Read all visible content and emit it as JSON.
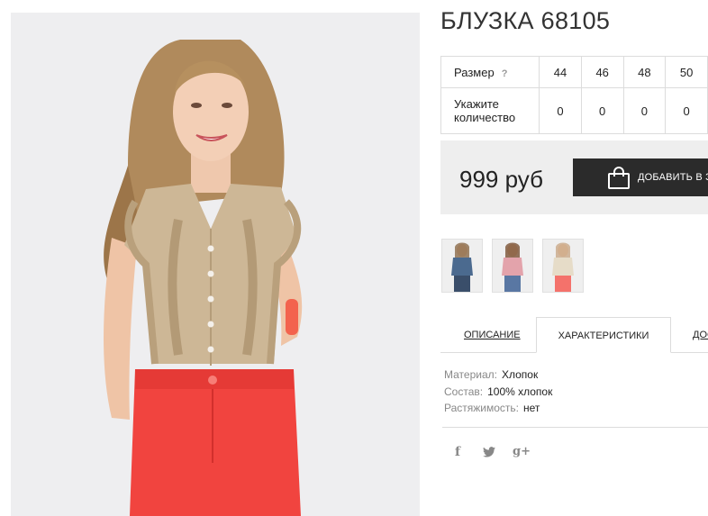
{
  "product": {
    "title": "БЛУЗКА 68105"
  },
  "size_table": {
    "size_label": "Размер",
    "help": "?",
    "sizes": [
      "44",
      "46",
      "48",
      "50"
    ],
    "qty_label": "Укажите количество",
    "qty": [
      "0",
      "0",
      "0",
      "0"
    ]
  },
  "price": {
    "value": "999 руб",
    "button": "ДОБАВИТЬ В З"
  },
  "tabs": {
    "description": "ОПИСАНИЕ",
    "characteristics": "ХАРАКТЕРИСТИКИ",
    "third": "ДОС"
  },
  "characteristics": [
    {
      "key": "Материал:",
      "value": "Хлопок"
    },
    {
      "key": "Состав:",
      "value": "100% хлопок"
    },
    {
      "key": "Растяжимость:",
      "value": "нет"
    }
  ],
  "social": {
    "facebook": "f",
    "twitter": "🐦",
    "gplus": "g+"
  },
  "thumbnail_colors": [
    "#4b6a8f",
    "#e3a3ab",
    "#e6dcc8"
  ]
}
